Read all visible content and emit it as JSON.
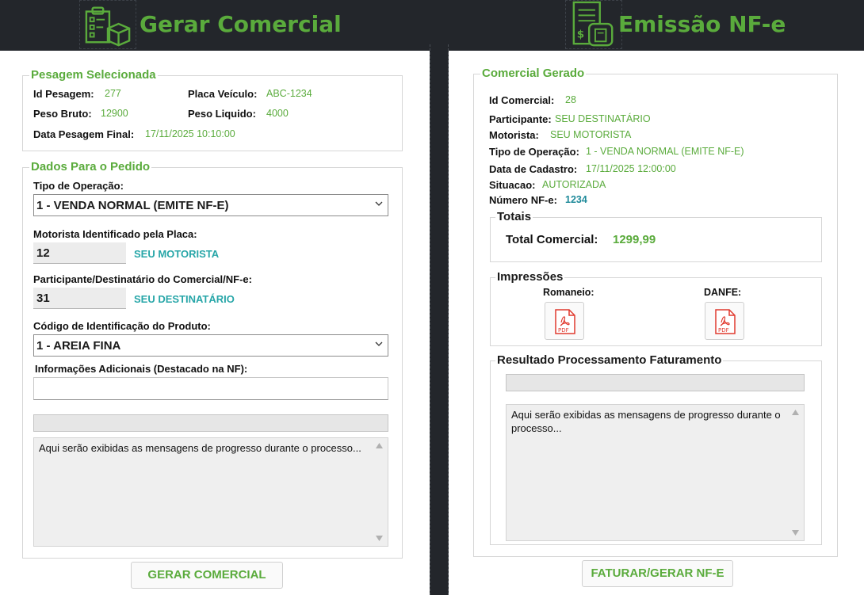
{
  "left_header": {
    "title": "Gerar Comercial",
    "icon": "checklist-box-icon"
  },
  "right_header": {
    "title": "Emissão NF-e",
    "icon": "invoice-document-icon"
  },
  "pesagem": {
    "title": "Pesagem Selecionada",
    "id_label": "Id Pesagem:",
    "id_value": "277",
    "placa_label": "Placa Veículo:",
    "placa_value": "ABC-1234",
    "bruto_label": "Peso Bruto:",
    "bruto_value": "12900",
    "liquido_label": "Peso Liquido:",
    "liquido_value": "4000",
    "data_label": "Data Pesagem Final:",
    "data_value": "17/11/2025 10:10:00"
  },
  "pedido": {
    "title": "Dados Para o Pedido",
    "tipo_label": "Tipo de Operação:",
    "tipo_value": "1 - VENDA NORMAL (EMITE NF-E)",
    "motorista_label": "Motorista Identificado pela Placa:",
    "motorista_code": "12",
    "motorista_name": "SEU MOTORISTA",
    "participante_label": "Participante/Destinatário do Comercial/NF-e:",
    "participante_code": "31",
    "participante_name": "SEU DESTINATÁRIO",
    "produto_label": "Código de Identificação do Produto:",
    "produto_value": "1 - AREIA FINA",
    "info_label": "Informações Adicionais (Destacado na NF):",
    "info_value": "",
    "log_text": "Aqui serão exibidas as mensagens de progresso durante o processo...",
    "button_label": "GERAR COMERCIAL"
  },
  "comercial": {
    "title": "Comercial Gerado",
    "id_label": "Id Comercial:",
    "id_value": "28",
    "participante_label": "Participante:",
    "participante_value": "SEU DESTINATÁRIO",
    "motorista_label": "Motorista:",
    "motorista_value": "SEU MOTORISTA",
    "tipo_label": "Tipo de Operação:",
    "tipo_value": "1 - VENDA NORMAL (EMITE NF-E)",
    "data_label": "Data de Cadastro:",
    "data_value": "17/11/2025 12:00:00",
    "situacao_label": "Situacao:",
    "situacao_value": "AUTORIZADA",
    "nfe_label": "Número NF-e:",
    "nfe_value": "1234"
  },
  "totais": {
    "title": "Totais",
    "total_label": "Total Comercial:",
    "total_value": "1299,99"
  },
  "impressoes": {
    "title": "Impressões",
    "romaneio_label": "Romaneio:",
    "danfe_label": "DANFE:",
    "pdf_text": "PDF"
  },
  "resultado": {
    "title": "Resultado Processamento Faturamento",
    "log_text": "Aqui serão exibidas as mensagens de progresso durante o processo...",
    "button_label": "FATURAR/GERAR NF-E"
  },
  "colors": {
    "accent": "#5aab3c",
    "teal": "#27a6a8",
    "dark": "#23262b"
  }
}
